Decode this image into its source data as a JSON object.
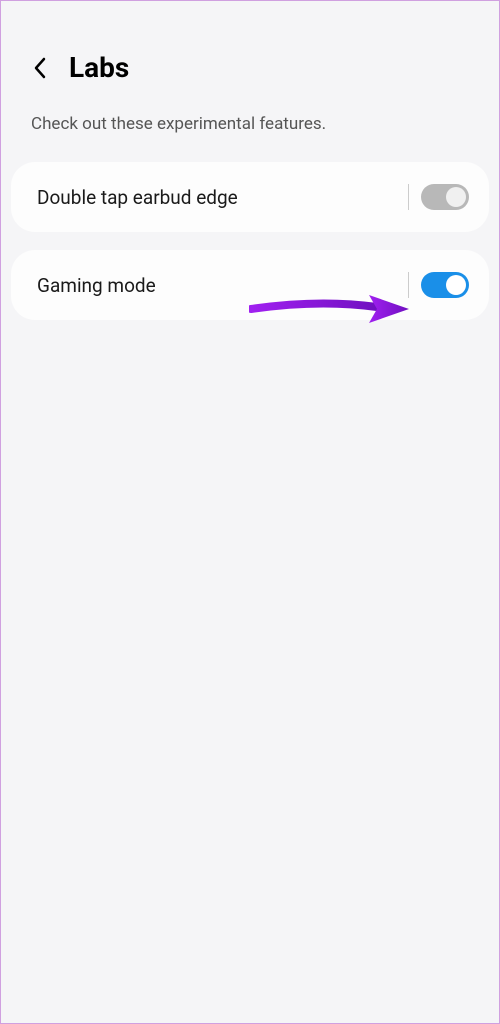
{
  "header": {
    "title": "Labs"
  },
  "subtitle": "Check out these experimental features.",
  "settings": [
    {
      "label": "Double tap earbud edge",
      "enabled": false
    },
    {
      "label": "Gaming mode",
      "enabled": true
    }
  ],
  "annotation": {
    "color": "#8e2de2"
  }
}
